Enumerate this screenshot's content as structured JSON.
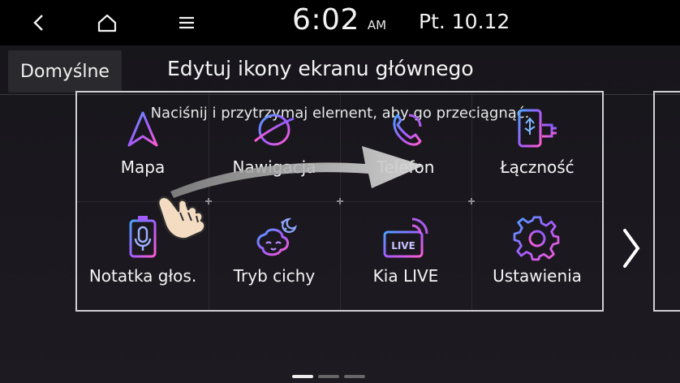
{
  "status": {
    "time": "6:02",
    "ampm": "AM",
    "date": "Pt. 10.12"
  },
  "nav": {
    "back_icon": "chevron-left-icon",
    "home_icon": "home-icon",
    "menu_icon": "menu-icon"
  },
  "header": {
    "default_label": "Domyślne",
    "title": "Edytuj ikony ekranu głównego"
  },
  "instruction": "Naciśnij i przytrzymaj element, aby go przeciągnąć.",
  "apps": [
    {
      "label": "Mapa",
      "icon": "navigation-arrow-icon"
    },
    {
      "label": "Nawigacja",
      "icon": "planet-icon"
    },
    {
      "label": "Telefon",
      "icon": "phone-icon"
    },
    {
      "label": "Łączność",
      "icon": "usb-connectivity-icon"
    },
    {
      "label": "Notatka głos.",
      "icon": "voice-memo-icon"
    },
    {
      "label": "Tryb cichy",
      "icon": "quiet-mode-icon"
    },
    {
      "label": "Kia LIVE",
      "icon": "kia-live-icon"
    },
    {
      "label": "Ustawienia",
      "icon": "gear-icon"
    }
  ],
  "pagination": {
    "pages": 3,
    "current": 1
  },
  "colors": {
    "accent_purple": "#a25cff",
    "accent_blue": "#4aa3ff",
    "accent_pink": "#ff5cd1"
  }
}
